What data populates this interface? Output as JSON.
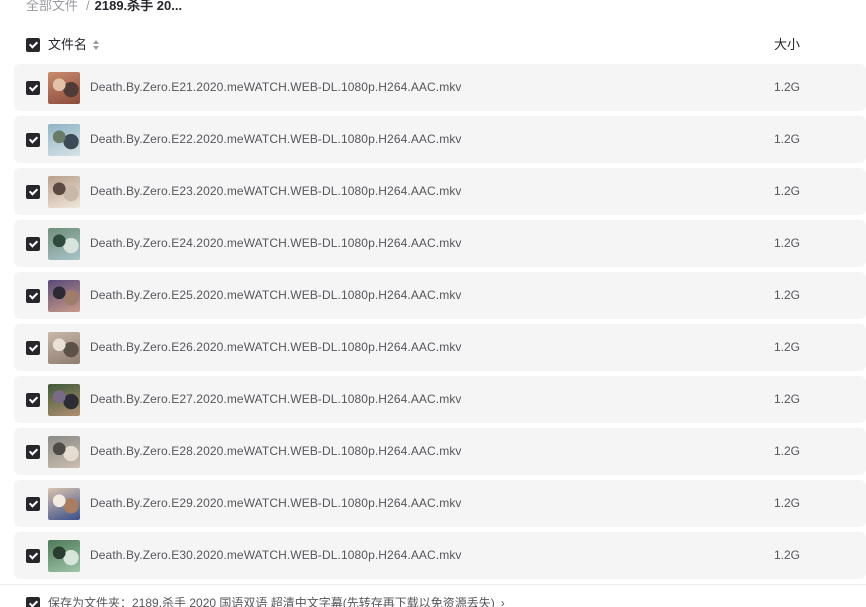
{
  "breadcrumb": {
    "root": "全部文件",
    "separator": "/",
    "current": "2189.杀手 20..."
  },
  "header": {
    "name_label": "文件名",
    "size_label": "大小",
    "sort_icon": "sort-arrows-icon"
  },
  "files": [
    {
      "name": "Death.By.Zero.E21.2020.meWATCH.WEB-DL.1080p.H264.AAC.mkv",
      "size": "1.2G",
      "checked": true
    },
    {
      "name": "Death.By.Zero.E22.2020.meWATCH.WEB-DL.1080p.H264.AAC.mkv",
      "size": "1.2G",
      "checked": true
    },
    {
      "name": "Death.By.Zero.E23.2020.meWATCH.WEB-DL.1080p.H264.AAC.mkv",
      "size": "1.2G",
      "checked": true
    },
    {
      "name": "Death.By.Zero.E24.2020.meWATCH.WEB-DL.1080p.H264.AAC.mkv",
      "size": "1.2G",
      "checked": true
    },
    {
      "name": "Death.By.Zero.E25.2020.meWATCH.WEB-DL.1080p.H264.AAC.mkv",
      "size": "1.2G",
      "checked": true
    },
    {
      "name": "Death.By.Zero.E26.2020.meWATCH.WEB-DL.1080p.H264.AAC.mkv",
      "size": "1.2G",
      "checked": true
    },
    {
      "name": "Death.By.Zero.E27.2020.meWATCH.WEB-DL.1080p.H264.AAC.mkv",
      "size": "1.2G",
      "checked": true
    },
    {
      "name": "Death.By.Zero.E28.2020.meWATCH.WEB-DL.1080p.H264.AAC.mkv",
      "size": "1.2G",
      "checked": true
    },
    {
      "name": "Death.By.Zero.E29.2020.meWATCH.WEB-DL.1080p.H264.AAC.mkv",
      "size": "1.2G",
      "checked": true
    },
    {
      "name": "Death.By.Zero.E30.2020.meWATCH.WEB-DL.1080p.H264.AAC.mkv",
      "size": "1.2G",
      "checked": true
    }
  ],
  "footer": {
    "save_text": "保存为文件夹：2189.杀手 2020 国语双语 超清中文字幕(先转存再下载以免资源丢失)",
    "arrow": "›",
    "checked": true
  },
  "colors": {
    "checkbox": "#26262b",
    "row_background": "#f5f5f6",
    "text_primary": "#25262b",
    "text_secondary": "#55565b",
    "text_muted": "#9a9aa0"
  }
}
